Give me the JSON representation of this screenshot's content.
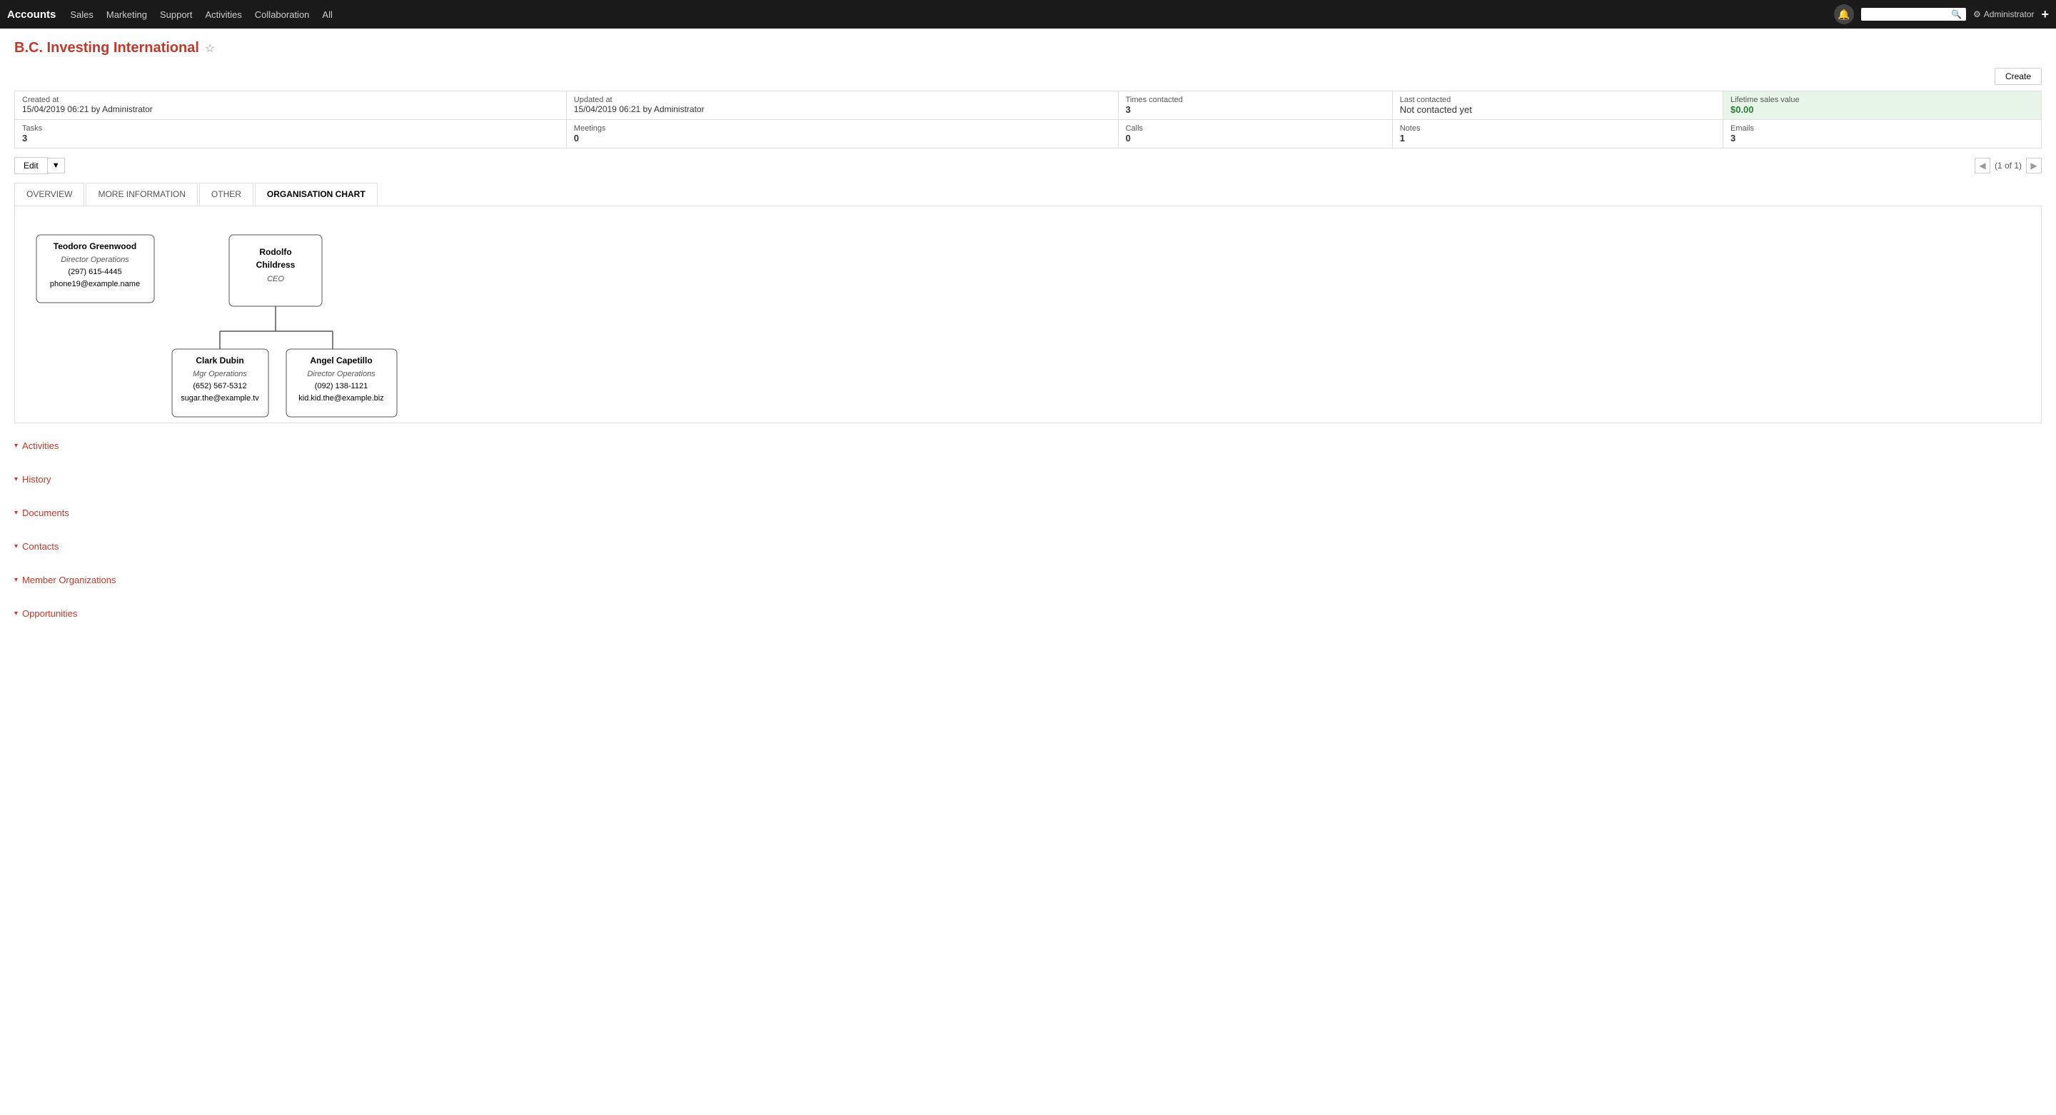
{
  "nav": {
    "brand": "Accounts",
    "links": [
      "Sales",
      "Marketing",
      "Support",
      "Activities",
      "Collaboration",
      "All"
    ],
    "search_placeholder": "",
    "admin_label": "Administrator"
  },
  "page": {
    "title": "B.C. Investing International",
    "create_btn": "Create"
  },
  "stats": {
    "row1": [
      {
        "label": "Created at",
        "value": "15/04/2019 06:21 by Administrator"
      },
      {
        "label": "Updated at",
        "value": "15/04/2019 06:21 by Administrator"
      },
      {
        "label": "Times contacted",
        "value": "3"
      },
      {
        "label": "Last contacted",
        "value": "Not contacted yet"
      },
      {
        "label": "Lifetime sales value",
        "value": "$0.00",
        "green": true
      }
    ],
    "row2": [
      {
        "label": "Tasks",
        "value": "3"
      },
      {
        "label": "Meetings",
        "value": "0"
      },
      {
        "label": "Calls",
        "value": "0"
      },
      {
        "label": "Notes",
        "value": "1"
      },
      {
        "label": "Emails",
        "value": "3"
      }
    ]
  },
  "edit": {
    "btn_label": "Edit",
    "pagination": "(1 of 1)"
  },
  "tabs": [
    {
      "id": "overview",
      "label": "OVERVIEW",
      "active": false
    },
    {
      "id": "more-information",
      "label": "MORE INFORMATION",
      "active": false
    },
    {
      "id": "other",
      "label": "OTHER",
      "active": false
    },
    {
      "id": "organisation-chart",
      "label": "ORGANISATION CHART",
      "active": true
    }
  ],
  "org_chart": {
    "nodes": [
      {
        "id": "teodoro",
        "name": "Teodoro Greenwood",
        "title": "Director Operations",
        "phone": "(297) 615-4445",
        "email": "phone19@example.name",
        "col": 0,
        "row": 0
      },
      {
        "id": "rodolfo",
        "name": "Rodolfo Childress",
        "title": "CEO",
        "phone": "",
        "email": "",
        "col": 1,
        "row": 0
      },
      {
        "id": "clark",
        "name": "Clark Dubin",
        "title": "Mgr Operations",
        "phone": "(652) 567-5312",
        "email": "sugar.the@example.tv",
        "col": 1,
        "row": 1
      },
      {
        "id": "angel",
        "name": "Angel Capetillo",
        "title": "Director Operations",
        "phone": "(092) 138-1121",
        "email": "kid.kid.the@example.biz",
        "col": 2,
        "row": 1
      }
    ]
  },
  "sections": [
    {
      "id": "activities",
      "label": "Activities"
    },
    {
      "id": "history",
      "label": "History"
    },
    {
      "id": "documents",
      "label": "Documents"
    },
    {
      "id": "contacts",
      "label": "Contacts"
    },
    {
      "id": "member-organizations",
      "label": "Member Organizations"
    },
    {
      "id": "opportunities",
      "label": "Opportunities"
    }
  ]
}
